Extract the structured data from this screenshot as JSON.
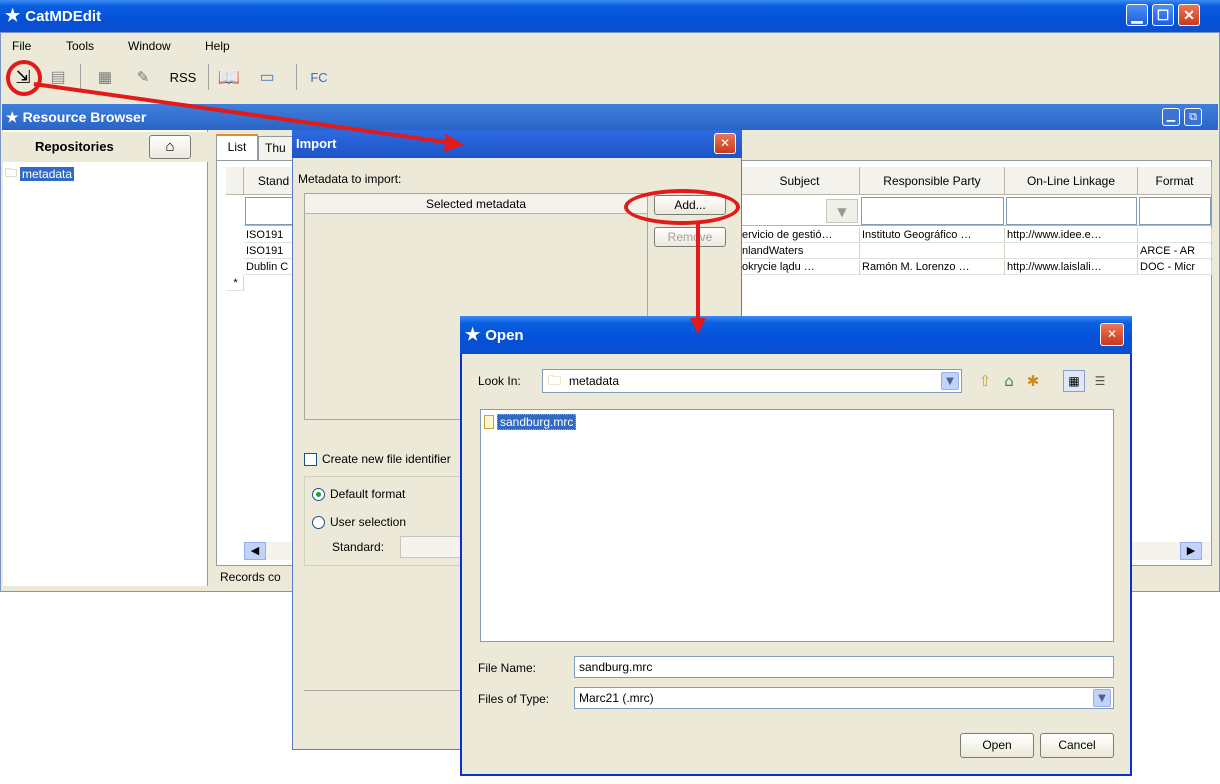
{
  "app": {
    "title": "CatMDEdit"
  },
  "menubar": [
    "File",
    "Tools",
    "Window",
    "Help"
  ],
  "toolbar": {
    "rss_label": "RSS",
    "fc_label": "FC"
  },
  "resource_browser": {
    "title": "Resource Browser",
    "repositories_label": "Repositories",
    "tree_item": "metadata",
    "tabs": [
      "List",
      "Thu"
    ],
    "columns_left": [
      "Stand"
    ],
    "columns_right": [
      "Subject",
      "Responsible Party",
      "On-Line Linkage",
      "Format"
    ],
    "rows_left": [
      "ISO191",
      "ISO191",
      "Dublin C"
    ],
    "rows_right": [
      [
        "ervicio de gestió…",
        "Instituto Geográfico …",
        "http://www.idee.e…",
        ""
      ],
      [
        "nlandWaters",
        "",
        "",
        "ARCE - AR"
      ],
      [
        "okrycie lądu   …",
        "Ramón M. Lorenzo …",
        "http://www.laislali…",
        "DOC - Micr"
      ]
    ],
    "new_row_marker": "*",
    "records_label": "Records co"
  },
  "import_dialog": {
    "title": "Import",
    "metadata_label": "Metadata to import:",
    "selected_header": "Selected metadata",
    "add_button": "Add...",
    "remove_button": "Remove",
    "create_identifier_label": "Create new file identifier",
    "default_format_label": "Default format",
    "user_selection_label": "User selection",
    "standard_label": "Standard:"
  },
  "open_dialog": {
    "title": "Open",
    "look_in_label": "Look In:",
    "look_in_value": "metadata",
    "files": [
      "sandburg.mrc"
    ],
    "file_name_label": "File Name:",
    "file_name_value": "sandburg.mrc",
    "files_of_type_label": "Files of Type:",
    "files_of_type_value": "Marc21 (.mrc)",
    "open_button": "Open",
    "cancel_button": "Cancel"
  },
  "colors": {
    "xp_blue": "#0a5fe0",
    "annotation_red": "#e21a1a",
    "selection": "#316ac5",
    "panel": "#ece9d8"
  }
}
